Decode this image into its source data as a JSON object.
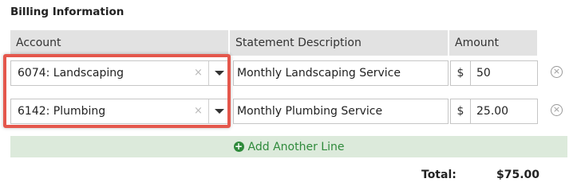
{
  "section": {
    "title": "Billing Information"
  },
  "table": {
    "headers": {
      "account": "Account",
      "description": "Statement Description",
      "amount": "Amount"
    }
  },
  "lines": [
    {
      "account": "6074: Landscaping",
      "description": "Monthly Landscaping Service",
      "currency": "$",
      "amount": "50"
    },
    {
      "account": "6142: Plumbing",
      "description": "Monthly Plumbing Service",
      "currency": "$",
      "amount": "25.00"
    }
  ],
  "icons": {
    "clear": "×",
    "remove": "×",
    "add": "+"
  },
  "add_line": {
    "label": "Add Another Line"
  },
  "totals": {
    "label": "Total:",
    "value": "$75.00"
  },
  "colors": {
    "highlight": "#e4574c",
    "add_line_bg": "#dceadb",
    "add_line_text": "#2f8a3b",
    "header_bg": "#e2e2e2"
  }
}
